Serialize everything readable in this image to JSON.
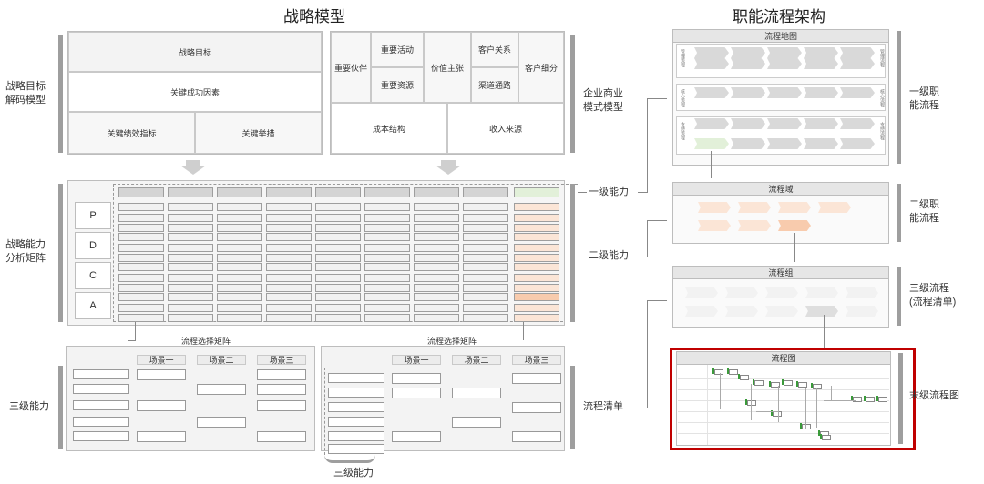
{
  "titles": {
    "left": "战略模型",
    "right": "职能流程架构"
  },
  "strategy_decode": {
    "side_label": "战略目标\n解码模型",
    "goal": "战略目标",
    "csf": "关键成功因素",
    "kpi": "关键绩效指标",
    "measures": "关键举措"
  },
  "business_model": {
    "side_label": "企业商业\n模式模型",
    "partners": "重要伙伴",
    "activities": "重要活动",
    "resources": "重要资源",
    "value": "价值主张",
    "relations": "客户关系",
    "channels": "渠道通路",
    "segments": "客户细分",
    "cost": "成本结构",
    "revenue": "收入来源"
  },
  "capability_matrix": {
    "side_label": "战略能力\n分析矩阵",
    "rows": [
      "P",
      "D",
      "C",
      "A"
    ],
    "level1_label": "一级能力",
    "level2_label": "二级能力"
  },
  "selection": {
    "side_label_left": "三级能力",
    "side_label_right": "流程清单",
    "left_title": "流程选择矩阵",
    "right_title": "流程选择矩阵",
    "scenes": [
      "场景一",
      "场景二",
      "场景三"
    ],
    "bottom_label": "三级能力"
  },
  "process_arch": {
    "l1_title": "流程地图",
    "l1_label": "一级职\n能流程",
    "l1_side_tags": [
      "管理流程",
      "核心流程",
      "支持流程"
    ],
    "l2_title": "流程域",
    "l2_label": "二级职\n能流程",
    "l3_title": "流程组",
    "l3_label": "三级流程\n(流程清单)",
    "l4_title": "流程图",
    "l4_label": "末级流程图"
  },
  "colors": {
    "highlight_red": "#c00000",
    "green": "#e2f0d9",
    "orange": "#f8cbad",
    "orange_light": "#fbe5d6"
  }
}
